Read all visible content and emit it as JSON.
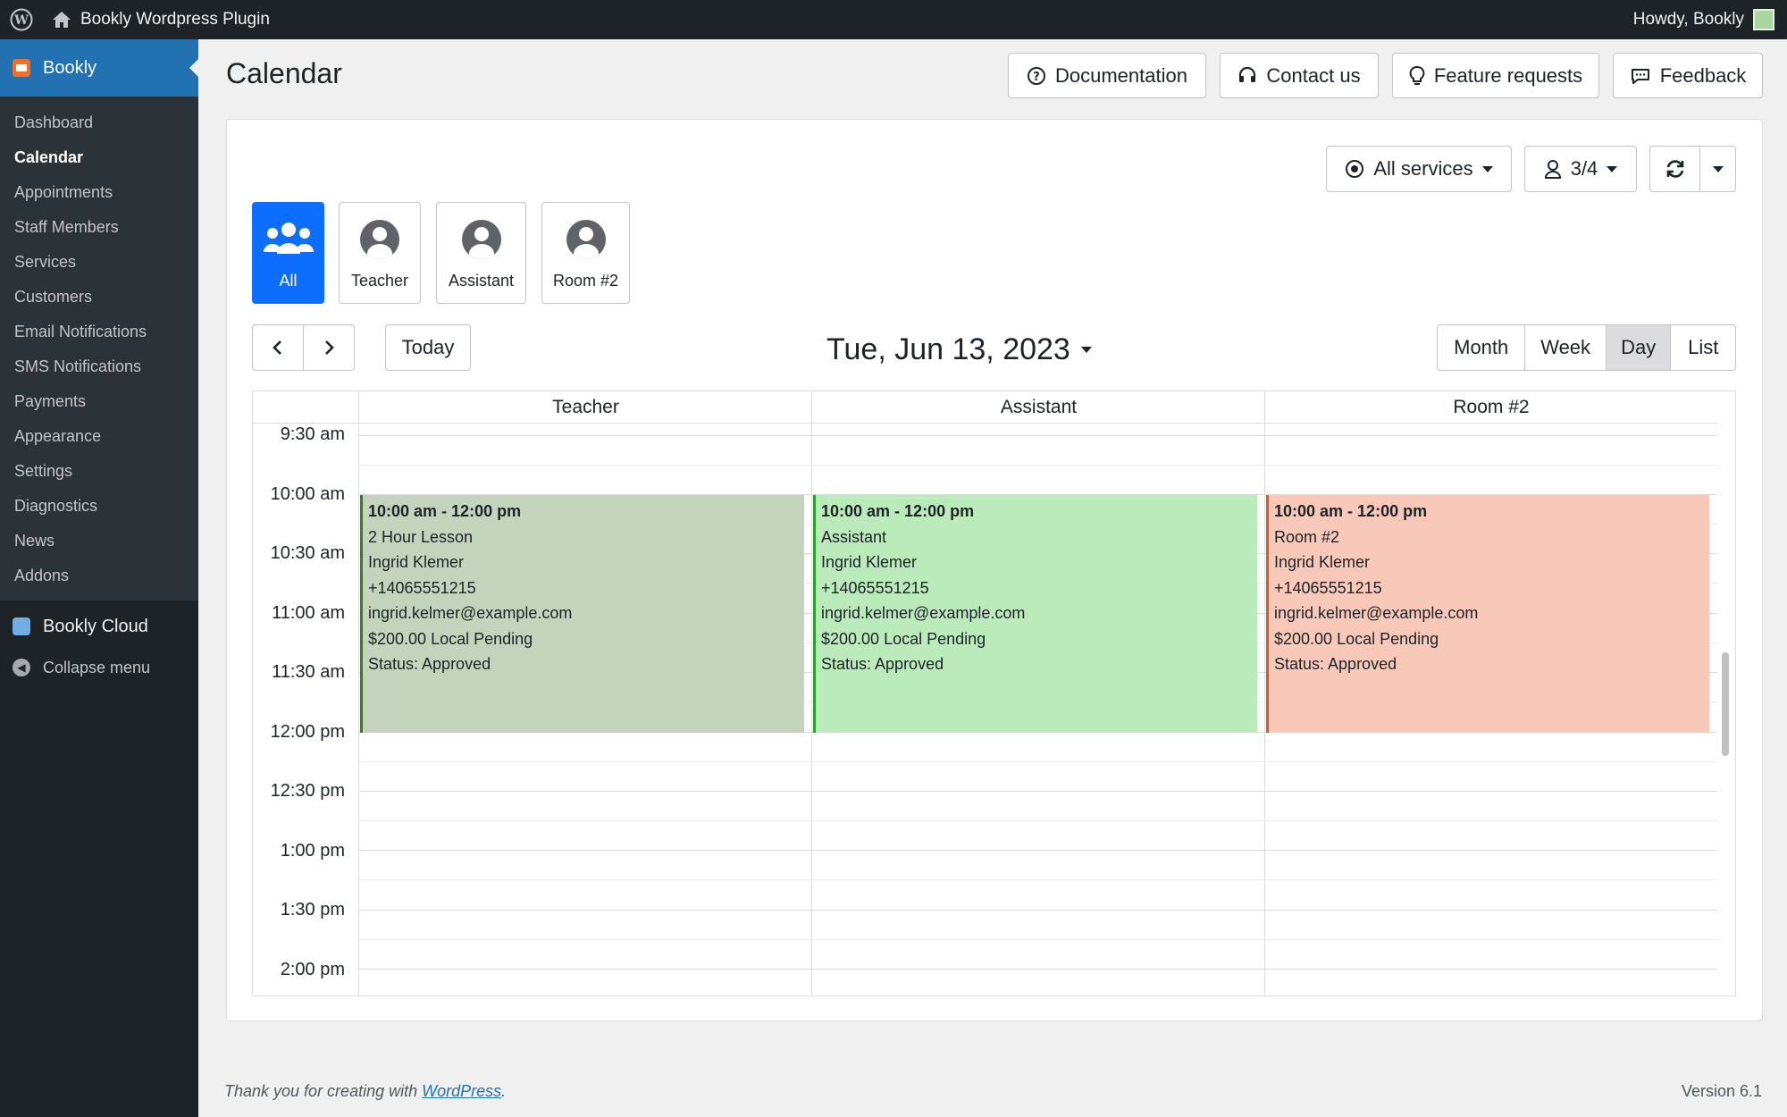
{
  "adminbar": {
    "site_name": "Bookly Wordpress Plugin",
    "howdy": "Howdy, Bookly"
  },
  "sidebar": {
    "top_label": "Bookly",
    "items": [
      "Dashboard",
      "Calendar",
      "Appointments",
      "Staff Members",
      "Services",
      "Customers",
      "Email Notifications",
      "SMS Notifications",
      "Payments",
      "Appearance",
      "Settings",
      "Diagnostics",
      "News",
      "Addons"
    ],
    "current": "Calendar",
    "cloud_label": "Bookly Cloud",
    "collapse_label": "Collapse menu"
  },
  "header": {
    "title": "Calendar",
    "buttons": [
      "Documentation",
      "Contact us",
      "Feature requests",
      "Feedback"
    ]
  },
  "toolbar": {
    "services_label": "All services",
    "staff_count": "3/4"
  },
  "staff_filter": {
    "items": [
      "All",
      "Teacher",
      "Assistant",
      "Room #2"
    ],
    "active": "All"
  },
  "calendar": {
    "today_label": "Today",
    "date_title": "Tue, Jun 13, 2023",
    "views": [
      "Month",
      "Week",
      "Day",
      "List"
    ],
    "active_view": "Day",
    "columns": [
      "Teacher",
      "Assistant",
      "Room #2"
    ],
    "time_labels": [
      "9:30 am",
      "10:00 am",
      "10:30 am",
      "11:00 am",
      "11:30 am",
      "12:00 pm",
      "12:30 pm",
      "1:00 pm",
      "1:30 pm",
      "2:00 pm"
    ],
    "events": [
      {
        "time": "10:00 am - 12:00 pm",
        "service": "2 Hour Lesson",
        "customer": "Ingrid Klemer",
        "phone": "+14065551215",
        "email": "ingrid.kelmer@example.com",
        "payment": "$200.00 Local Pending",
        "status": "Status: Approved",
        "bg": "#c4d4bc",
        "border": "#3b7a2a"
      },
      {
        "time": "10:00 am - 12:00 pm",
        "service": "Assistant",
        "customer": "Ingrid Klemer",
        "phone": "+14065551215",
        "email": "ingrid.kelmer@example.com",
        "payment": "$200.00 Local Pending",
        "status": "Status: Approved",
        "bg": "#bbeabb",
        "border": "#25a325"
      },
      {
        "time": "10:00 am - 12:00 pm",
        "service": "Room #2",
        "customer": "Ingrid Klemer",
        "phone": "+14065551215",
        "email": "ingrid.kelmer@example.com",
        "payment": "$200.00 Local Pending",
        "status": "Status: Approved",
        "bg": "#f8c8b8",
        "border": "#e0542a"
      }
    ]
  },
  "footer": {
    "thanks_prefix": "Thank you for creating with ",
    "link": "WordPress",
    "suffix": ".",
    "version": "Version 6.1"
  }
}
